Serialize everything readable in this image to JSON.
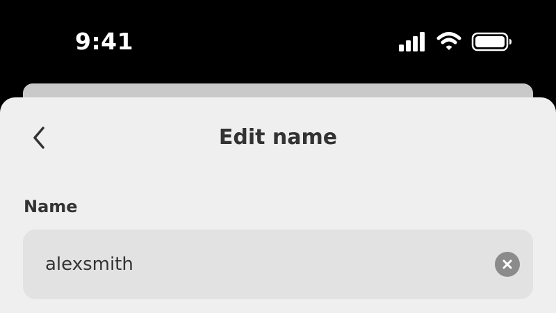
{
  "status_bar": {
    "time": "9:41",
    "icons": [
      "cellular-signal-icon",
      "wifi-icon",
      "battery-icon"
    ]
  },
  "sheet": {
    "title": "Edit name",
    "back_icon": "chevron-left-icon",
    "field_label": "Name",
    "input_value": "alexsmith",
    "clear_icon": "clear-x-icon"
  },
  "colors": {
    "background": "#000000",
    "sheet": "#efefef",
    "sheet_back": "#c9c9c9",
    "input_background": "#e2e2e2",
    "text": "#333333",
    "clear_button": "#8b8b8b"
  }
}
